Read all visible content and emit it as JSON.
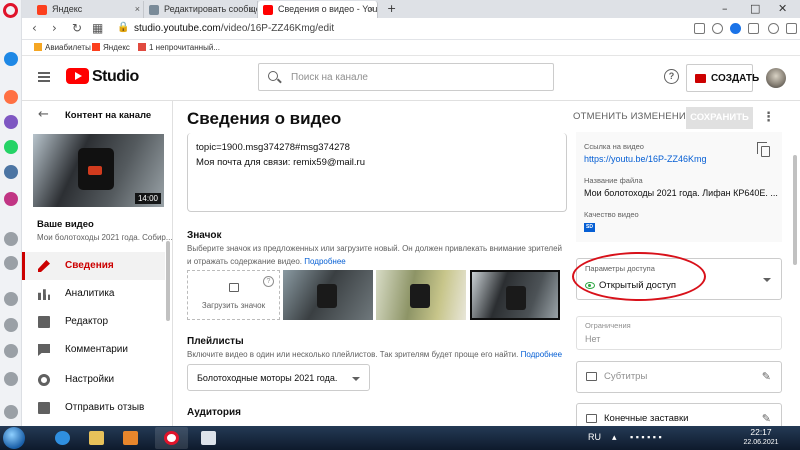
{
  "browser": {
    "tabs": [
      {
        "title": "Яндекс"
      },
      {
        "title": "Редактировать сообщение"
      },
      {
        "title": "Сведения о видео - YouTube"
      }
    ],
    "url_domain": "studio.youtube.com",
    "url_path": "/video/16P-ZZ46Kmg/edit",
    "bookmarks": [
      {
        "label": "Авиабилеты"
      },
      {
        "label": "Яндекс"
      },
      {
        "label": "1 непрочитанный..."
      }
    ]
  },
  "header": {
    "logo_text": "Studio",
    "search_placeholder": "Поиск на канале",
    "help_glyph": "?",
    "create_label": "СОЗДАТЬ"
  },
  "sidebar": {
    "channel_title": "Контент на канале",
    "thumb_duration": "14:00",
    "video_label": "Ваше видео",
    "video_name": "Мои болотоходы 2021 года. Собир...",
    "items": [
      {
        "label": "Сведения",
        "icon": "pencil-icon"
      },
      {
        "label": "Аналитика",
        "icon": "analytics-icon"
      },
      {
        "label": "Редактор",
        "icon": "film-icon"
      },
      {
        "label": "Комментарии",
        "icon": "comment-icon"
      },
      {
        "label": "Настройки",
        "icon": "gear-icon"
      },
      {
        "label": "Отправить отзыв",
        "icon": "feedback-icon"
      }
    ]
  },
  "main": {
    "title": "Сведения о видео",
    "undo_label": "ОТМЕНИТЬ ИЗМЕНЕНИЯ",
    "save_label": "СОХРАНИТЬ",
    "description_lines": [
      "topic=1900.msg374278#msg374278",
      "Моя почта для связи: remix59@mail.ru"
    ],
    "thumbnail": {
      "title": "Значок",
      "help": "Выберите значок из предложенных или загрузите новый. Он должен привлекать внимание зрителей и отражать содержание видео.",
      "more": "Подробнее",
      "upload_label": "Загрузить значок",
      "upload_help": "?"
    },
    "playlists": {
      "title": "Плейлисты",
      "help": "Включите видео в один или несколько плейлистов. Так зрителям будет проще его найти.",
      "more": "Подробнее",
      "selected": "Болотоходные моторы 2021 года."
    },
    "audience_title": "Аудитория"
  },
  "right": {
    "link_label": "Ссылка на видео",
    "link_value": "https://youtu.be/16P-ZZ46Kmg",
    "file_label": "Название файла",
    "file_value": "Мои болотоходы 2021 года. Лифан КР640Е. ...",
    "quality_label": "Качество видео",
    "quality_badge": "SD",
    "visibility_label": "Параметры доступа",
    "visibility_value": "Открытый доступ",
    "restrictions_label": "Ограничения",
    "restrictions_value": "Нет",
    "subtitles_label": "Субтитры",
    "endscreen_label": "Конечные заставки"
  },
  "taskbar": {
    "lang": "RU",
    "time": "22:17",
    "date": "22.06.2021"
  },
  "colors": {
    "yt_red": "#ff0000",
    "accent_red": "#cc0000",
    "link_blue": "#065fd4",
    "public_green": "#2ba640",
    "annotation_red": "#d8111a"
  }
}
